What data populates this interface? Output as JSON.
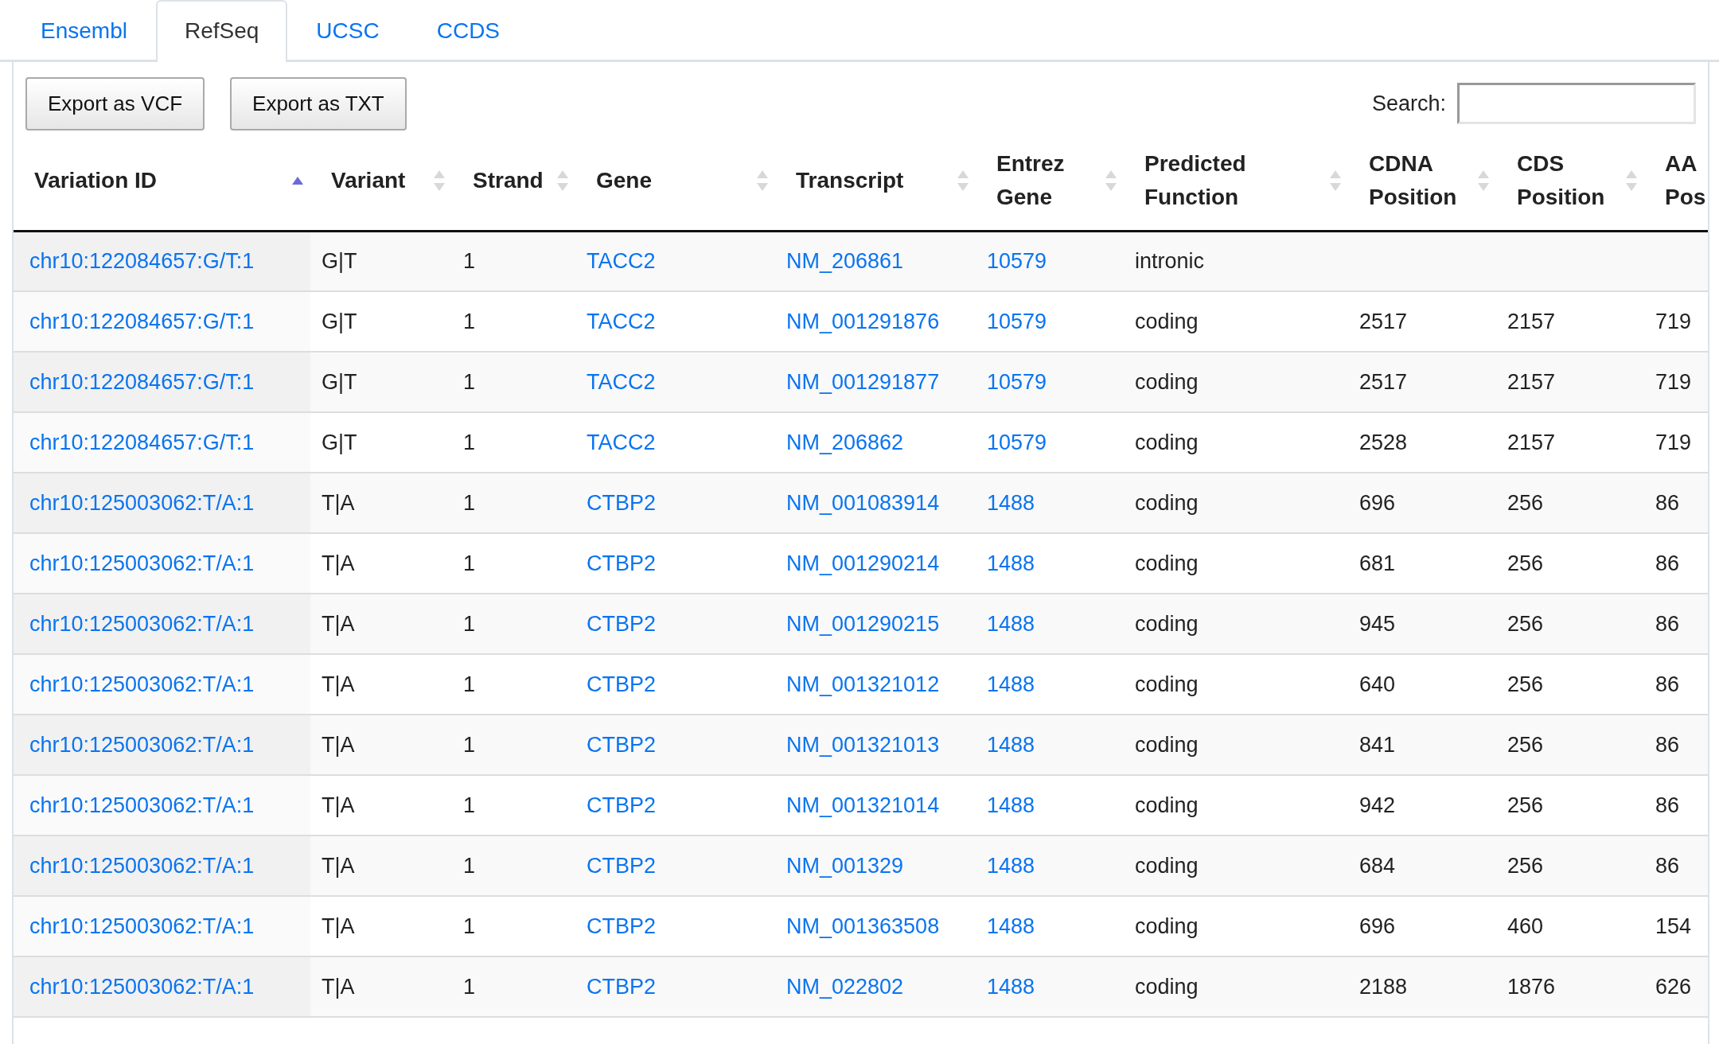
{
  "tabs": [
    {
      "label": "Ensembl",
      "selected": false
    },
    {
      "label": "RefSeq",
      "selected": true
    },
    {
      "label": "UCSC",
      "selected": false
    },
    {
      "label": "CCDS",
      "selected": false
    }
  ],
  "buttons": [
    "Export as VCF",
    "Export as TXT"
  ],
  "search": {
    "label": "Search:"
  },
  "table": {
    "columns": [
      {
        "label": "Variation ID",
        "sorted": true
      },
      {
        "label": "Variant",
        "sorted": false
      },
      {
        "label": "Strand",
        "sorted": false
      },
      {
        "label": "Gene",
        "sorted": false
      },
      {
        "label": "Transcript",
        "sorted": false
      },
      {
        "label": "Entrez Gene",
        "sorted": false
      },
      {
        "label": "Predicted Function",
        "sorted": false
      },
      {
        "label": "CDNA Position",
        "sorted": false
      },
      {
        "label": "CDS Position",
        "sorted": false
      },
      {
        "label": "AA Pos"
      }
    ],
    "rows": [
      [
        "chr10:122084657:G/T:1",
        "G|T",
        "1",
        "TACC2",
        "NM_206861",
        "10579",
        "intronic",
        "",
        "",
        ""
      ],
      [
        "chr10:122084657:G/T:1",
        "G|T",
        "1",
        "TACC2",
        "NM_001291876",
        "10579",
        "coding",
        "2517",
        "2157",
        "719"
      ],
      [
        "chr10:122084657:G/T:1",
        "G|T",
        "1",
        "TACC2",
        "NM_001291877",
        "10579",
        "coding",
        "2517",
        "2157",
        "719"
      ],
      [
        "chr10:122084657:G/T:1",
        "G|T",
        "1",
        "TACC2",
        "NM_206862",
        "10579",
        "coding",
        "2528",
        "2157",
        "719"
      ],
      [
        "chr10:125003062:T/A:1",
        "T|A",
        "1",
        "CTBP2",
        "NM_001083914",
        "1488",
        "coding",
        "696",
        "256",
        "86"
      ],
      [
        "chr10:125003062:T/A:1",
        "T|A",
        "1",
        "CTBP2",
        "NM_001290214",
        "1488",
        "coding",
        "681",
        "256",
        "86"
      ],
      [
        "chr10:125003062:T/A:1",
        "T|A",
        "1",
        "CTBP2",
        "NM_001290215",
        "1488",
        "coding",
        "945",
        "256",
        "86"
      ],
      [
        "chr10:125003062:T/A:1",
        "T|A",
        "1",
        "CTBP2",
        "NM_001321012",
        "1488",
        "coding",
        "640",
        "256",
        "86"
      ],
      [
        "chr10:125003062:T/A:1",
        "T|A",
        "1",
        "CTBP2",
        "NM_001321013",
        "1488",
        "coding",
        "841",
        "256",
        "86"
      ],
      [
        "chr10:125003062:T/A:1",
        "T|A",
        "1",
        "CTBP2",
        "NM_001321014",
        "1488",
        "coding",
        "942",
        "256",
        "86"
      ],
      [
        "chr10:125003062:T/A:1",
        "T|A",
        "1",
        "CTBP2",
        "NM_001329",
        "1488",
        "coding",
        "684",
        "256",
        "86"
      ],
      [
        "chr10:125003062:T/A:1",
        "T|A",
        "1",
        "CTBP2",
        "NM_001363508",
        "1488",
        "coding",
        "696",
        "460",
        "154"
      ],
      [
        "chr10:125003062:T/A:1",
        "T|A",
        "1",
        "CTBP2",
        "NM_022802",
        "1488",
        "coding",
        "2188",
        "1876",
        "626"
      ]
    ]
  }
}
